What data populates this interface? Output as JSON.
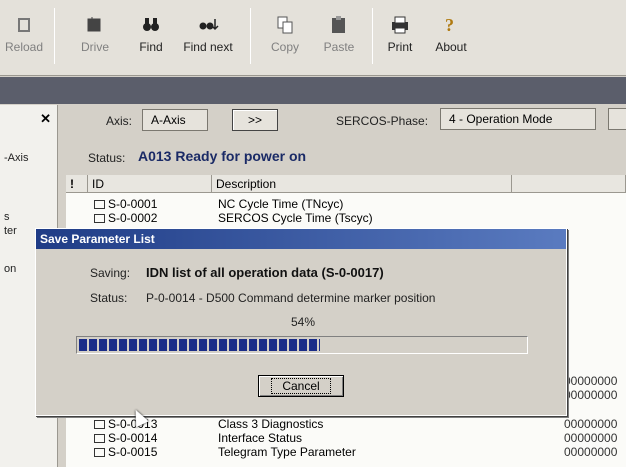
{
  "toolbar": {
    "buttons": [
      {
        "label": "Reload",
        "icon": "reload-icon",
        "enabled": false
      },
      {
        "label": "Drive",
        "icon": "drive-icon",
        "enabled": false
      },
      {
        "label": "Find",
        "icon": "binoculars-icon",
        "enabled": true
      },
      {
        "label": "Find next",
        "icon": "find-next-icon",
        "enabled": true
      },
      {
        "label": "Copy",
        "icon": "copy-icon",
        "enabled": false
      },
      {
        "label": "Paste",
        "icon": "paste-icon",
        "enabled": false
      },
      {
        "label": "Print",
        "icon": "printer-icon",
        "enabled": true
      },
      {
        "label": "About",
        "icon": "question-icon",
        "enabled": true
      }
    ]
  },
  "left_pane": {
    "close": "✕",
    "items": [
      "-Axis",
      "s",
      "ter",
      "on"
    ]
  },
  "header": {
    "axis_label": "Axis:",
    "axis_value": "A-Axis",
    "next_button": ">>",
    "phase_label": "SERCOS-Phase:",
    "phase_value": "4 - Operation Mode",
    "status_label": "Status:",
    "status_value": "A013 Ready for power on"
  },
  "table": {
    "columns": [
      "!",
      "ID",
      "Description"
    ],
    "rows": [
      {
        "id": "S-0-0001",
        "desc": "NC Cycle Time (TNcyc)",
        "val": ""
      },
      {
        "id": "S-0-0002",
        "desc": "SERCOS Cycle Time (Tscyc)",
        "val": ""
      },
      {
        "id": "S-0-0013",
        "desc": "Class 3 Diagnostics",
        "val": "00000000"
      },
      {
        "id": "S-0-0014",
        "desc": "Interface Status",
        "val": "00000000"
      },
      {
        "id": "S-0-0015",
        "desc": "Telegram Type Parameter",
        "val": "00000000"
      }
    ],
    "extra_values": [
      "00000000",
      "00000000"
    ]
  },
  "dialog": {
    "title": "Save Parameter List",
    "saving_label": "Saving:",
    "saving_value": "IDN list of all operation data (S-0-0017)",
    "status_label": "Status:",
    "status_value": "P-0-0014 - D500 Command determine marker position",
    "progress_text": "54%",
    "progress_fraction": 0.54,
    "cancel_label": "Cancel"
  },
  "colors": {
    "title_bar": "#1f3c86",
    "progress": "#1a2c88",
    "status_text": "#1a2a66"
  }
}
